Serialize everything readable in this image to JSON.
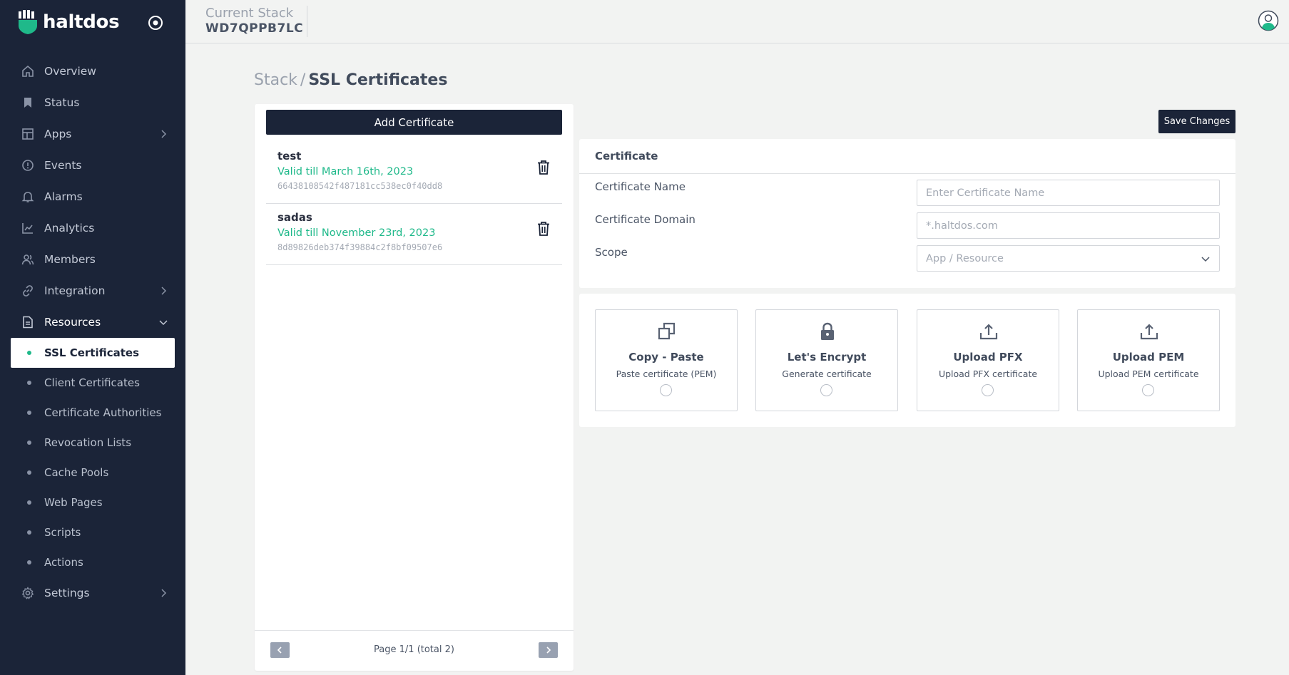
{
  "brand": {
    "name": "haltdos",
    "accent": "#1fb98a",
    "dark": "#1b2438"
  },
  "header": {
    "stack_label": "Current Stack",
    "stack_value": "WD7QPPB7LC"
  },
  "sidebar": {
    "items": [
      {
        "label": "Overview",
        "icon": "home-icon"
      },
      {
        "label": "Status",
        "icon": "bookmark-icon"
      },
      {
        "label": "Apps",
        "icon": "layout-icon"
      },
      {
        "label": "Events",
        "icon": "alert-circle-icon"
      },
      {
        "label": "Alarms",
        "icon": "bell-icon"
      },
      {
        "label": "Analytics",
        "icon": "line-chart-icon"
      },
      {
        "label": "Members",
        "icon": "users-icon"
      },
      {
        "label": "Integration",
        "icon": "link-icon"
      },
      {
        "label": "Resources",
        "icon": "document-icon"
      }
    ],
    "sub_items": [
      {
        "label": "SSL Certificates"
      },
      {
        "label": "Client Certificates"
      },
      {
        "label": "Certificate Authorities"
      },
      {
        "label": "Revocation Lists"
      },
      {
        "label": "Cache Pools"
      },
      {
        "label": "Web Pages"
      },
      {
        "label": "Scripts"
      },
      {
        "label": "Actions"
      }
    ],
    "settings": {
      "label": "Settings",
      "icon": "gear-icon"
    }
  },
  "breadcrumb": {
    "parent": "Stack",
    "separator": "/",
    "current": "SSL Certificates"
  },
  "list": {
    "add_label": "Add Certificate",
    "certs": [
      {
        "name": "test",
        "valid": "Valid till March 16th, 2023",
        "hash": "66438108542f487181cc538ec0f40dd8"
      },
      {
        "name": "sadas",
        "valid": "Valid till November 23rd, 2023",
        "hash": "8d89826deb374f39884c2f8bf09507e6"
      }
    ],
    "pager": "Page 1/1 (total 2)"
  },
  "save_label": "Save Changes",
  "form": {
    "title": "Certificate",
    "name_label": "Certificate Name",
    "name_placeholder": "Enter Certificate Name",
    "domain_label": "Certificate Domain",
    "domain_placeholder": "*.haltdos.com",
    "scope_label": "Scope",
    "scope_placeholder": "App / Resource"
  },
  "options": [
    {
      "title": "Copy - Paste",
      "sub": "Paste certificate (PEM)",
      "icon": "copy-icon"
    },
    {
      "title": "Let's Encrypt",
      "sub": "Generate certificate",
      "icon": "lock-icon"
    },
    {
      "title": "Upload PFX",
      "sub": "Upload PFX certificate",
      "icon": "upload-icon"
    },
    {
      "title": "Upload PEM",
      "sub": "Upload PEM certificate",
      "icon": "upload-icon"
    }
  ]
}
